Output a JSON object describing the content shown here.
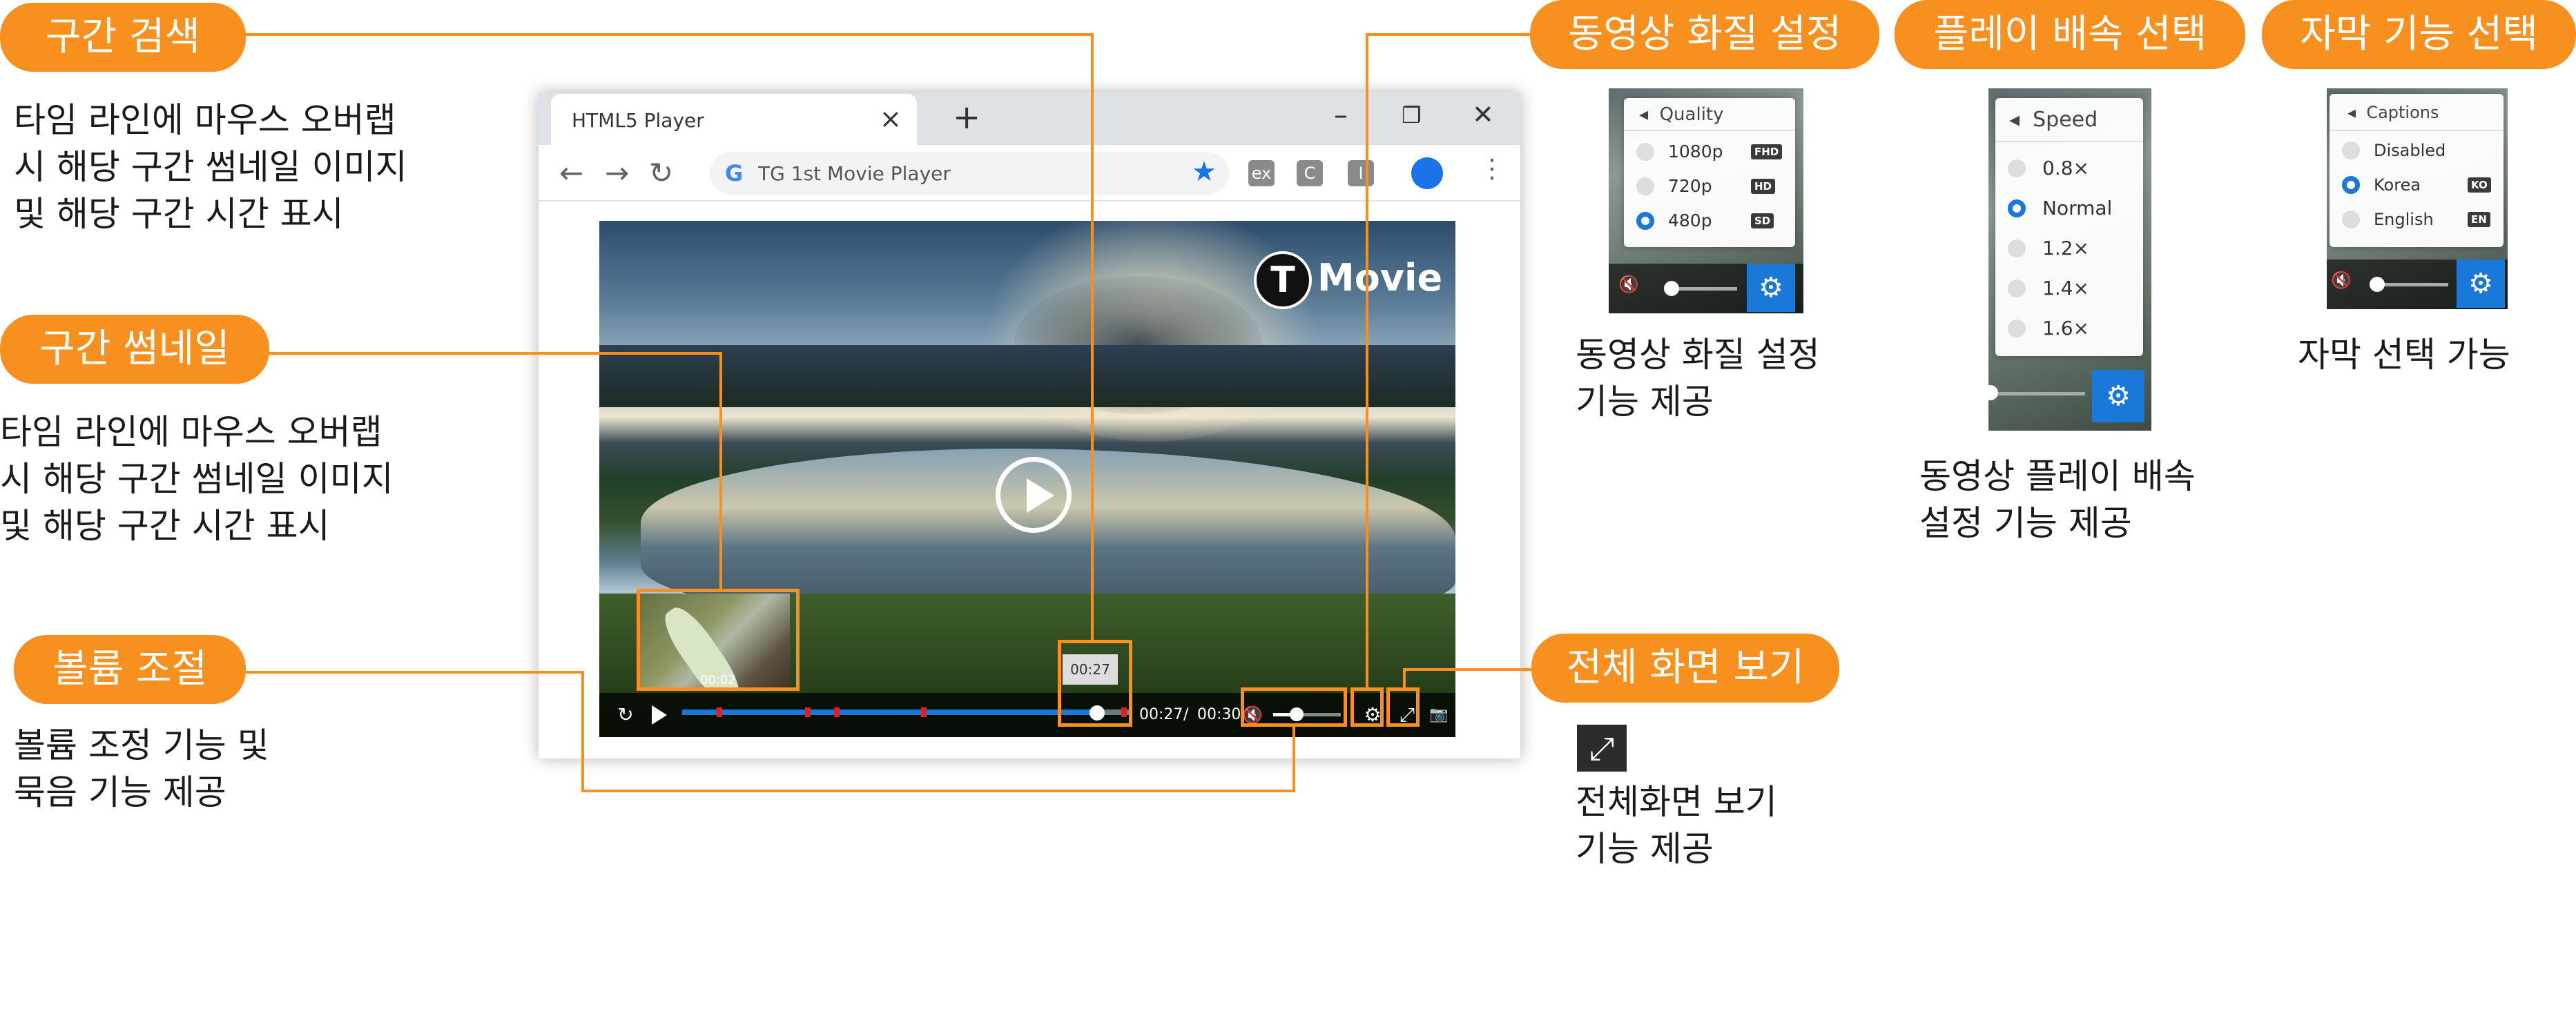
{
  "labels": {
    "section_search": "구간 검색",
    "section_thumbnail": "구간 썸네일",
    "volume_control": "볼륨 조절",
    "quality_setting": "동영상 화질 설정",
    "speed_select": "플레이 배속 선택",
    "caption_select": "자막 기능 선택",
    "fullscreen": "전체 화면 보기"
  },
  "descriptions": {
    "search_1": "타임 라인에 마우스 오버랩",
    "search_2": "시 해당 구간 썸네일 이미지",
    "search_3": "및 해당 구간 시간 표시",
    "thumb_1": "타임 라인에  마우스  오버랩",
    "thumb_2": "시 해당 구간 썸네일  이미지",
    "thumb_3": "및 해당 구간 시간 표시",
    "volume_1": "볼륨 조정 기능 및",
    "volume_2": "묵음 기능 제공",
    "quality_1": "동영상 화질 설정",
    "quality_2": "기능 제공",
    "speed_1": "동영상 플레이 배속",
    "speed_2": "설정 기능 제공",
    "caption_1": "자막  선택 가능",
    "fullscreen_1": "전체화면 보기",
    "fullscreen_2": "기능 제공"
  },
  "browser": {
    "tab_title": "HTML5 Player",
    "tab_close": "×",
    "new_tab": "+",
    "address": "TG 1st Movie Player",
    "window_min": "–",
    "window_restore": "❐",
    "window_close": "✕"
  },
  "player": {
    "logo_letter": "T",
    "logo_text": "Movie",
    "thumb_time": "00:02",
    "tooltip_time": "00:27",
    "current_time": "00:27",
    "separator": "/",
    "duration": "00:30",
    "progress_fraction": 0.92,
    "volume_fraction": 0.35
  },
  "quality_menu": {
    "title": "Quality",
    "options": [
      {
        "label": "1080p",
        "tag": "FHD",
        "selected": false
      },
      {
        "label": "720p",
        "tag": "HD",
        "selected": false
      },
      {
        "label": "480p",
        "tag": "SD",
        "selected": true
      }
    ]
  },
  "speed_menu": {
    "title": "Speed",
    "options": [
      {
        "label": "0.8×",
        "selected": false
      },
      {
        "label": "Normal",
        "selected": true
      },
      {
        "label": "1.2×",
        "selected": false
      },
      {
        "label": "1.4×",
        "selected": false
      },
      {
        "label": "1.6×",
        "selected": false
      }
    ]
  },
  "caption_menu": {
    "title": "Captions",
    "options": [
      {
        "label": "Disabled",
        "tag": "",
        "selected": false
      },
      {
        "label": "Korea",
        "tag": "KO",
        "selected": true
      },
      {
        "label": "English",
        "tag": "EN",
        "selected": false
      }
    ]
  },
  "colors": {
    "accent": "#f7901e",
    "player_blue": "#1a79d8",
    "marker_red": "#e02020"
  }
}
